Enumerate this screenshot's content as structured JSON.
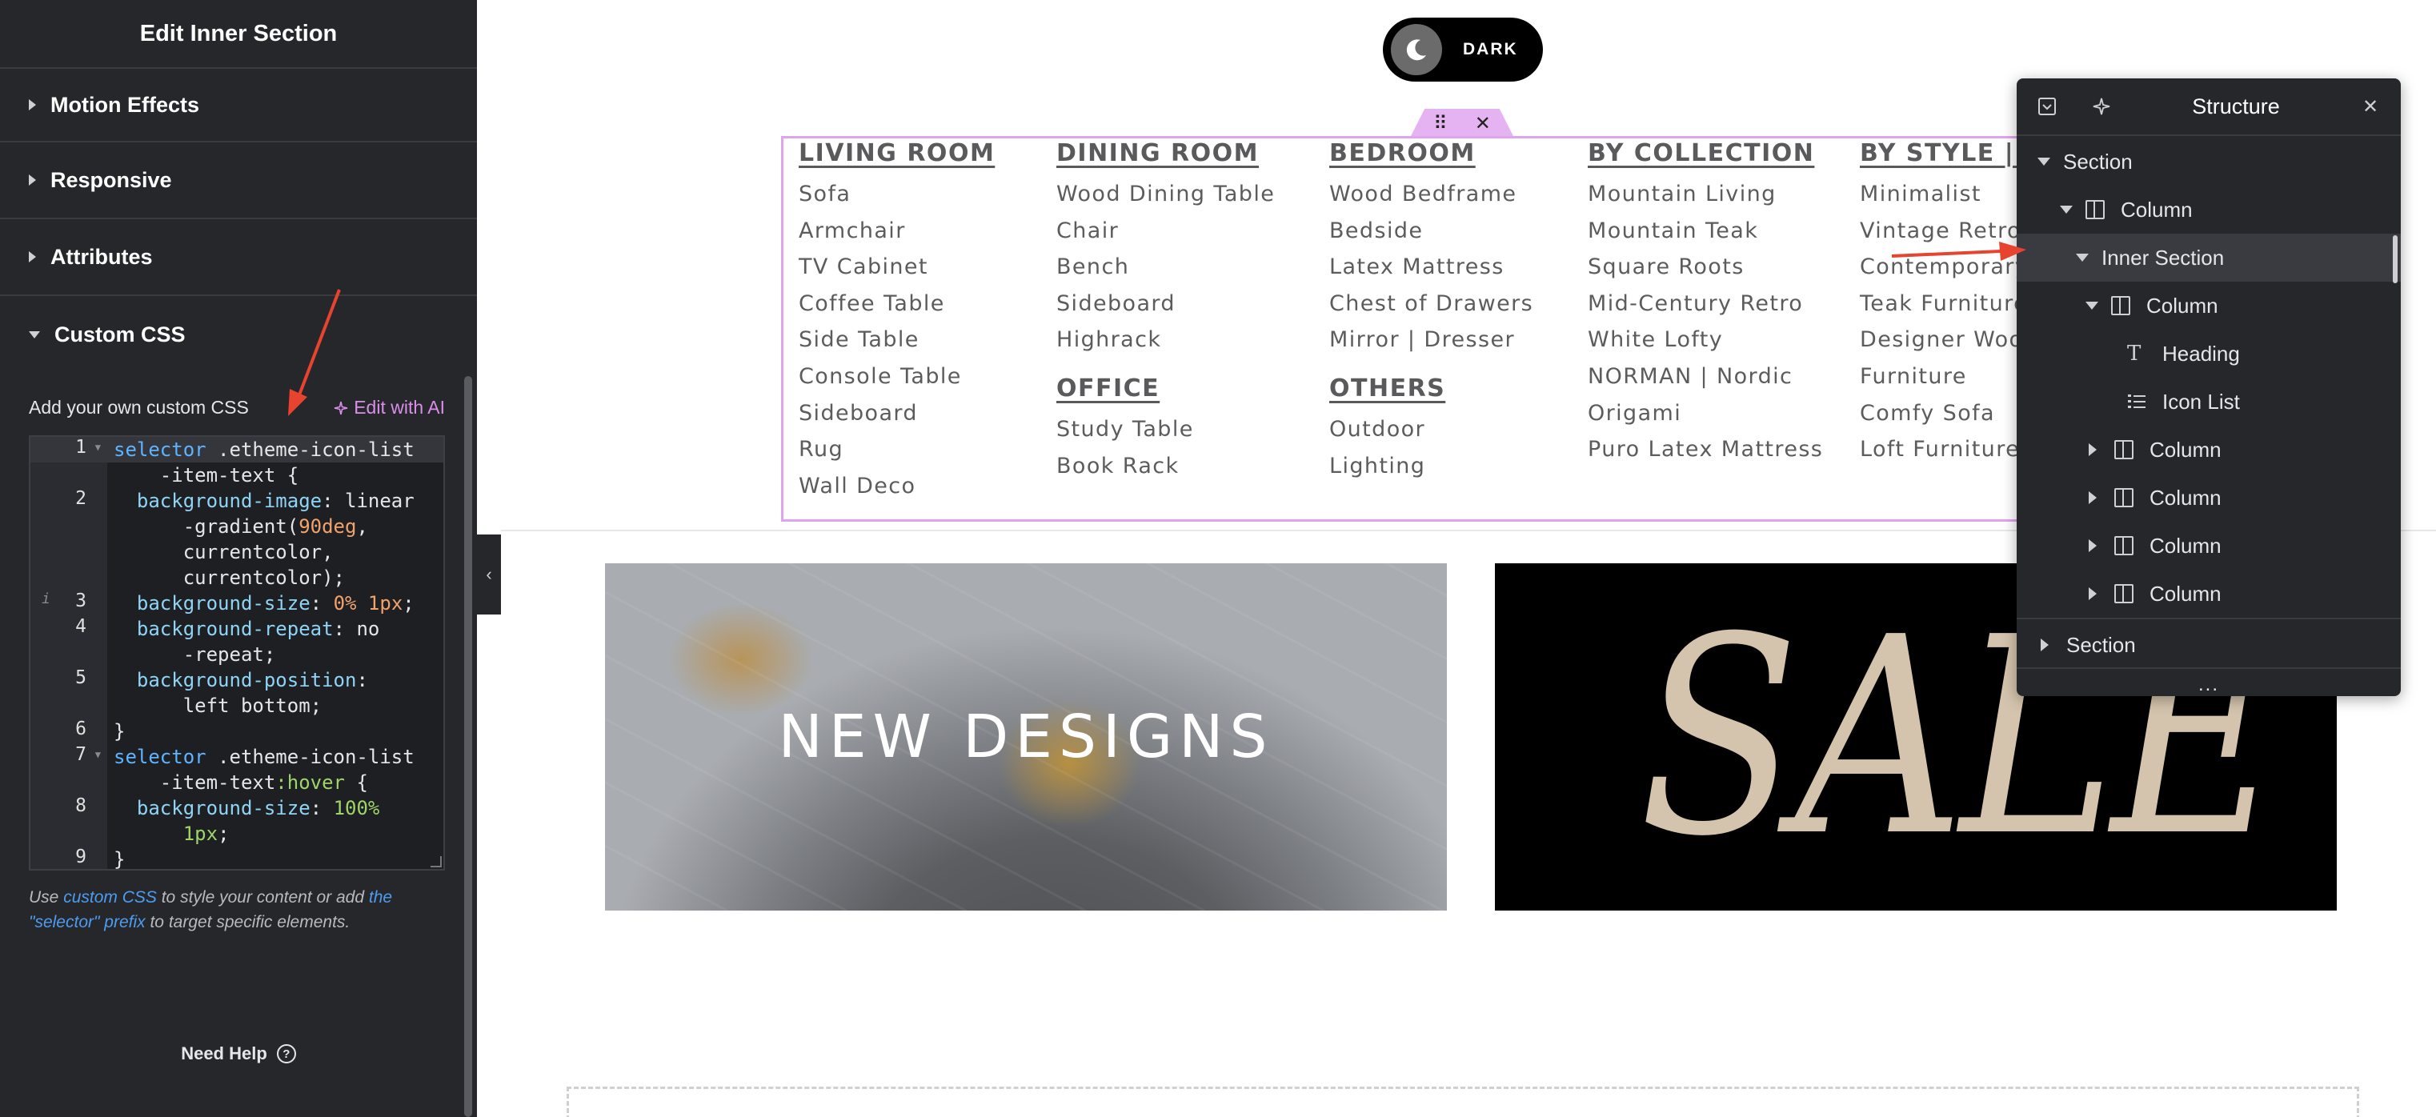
{
  "panel": {
    "title": "Edit Inner Section",
    "sections": {
      "motion": "Motion Effects",
      "responsive": "Responsive",
      "attributes": "Attributes",
      "custom_css": "Custom CSS"
    },
    "custom_css": {
      "label": "Add your own custom CSS",
      "edit_ai": "Edit with AI",
      "help_prefix": "Use ",
      "help_link1": "custom CSS",
      "help_middle": " to style your content or add ",
      "help_link2": "the \"selector\" prefix",
      "help_suffix": " to target specific elements."
    },
    "need_help": "Need Help"
  },
  "code_lines": [
    "1",
    "2",
    "3",
    "4",
    "5",
    "6",
    "7",
    "8",
    "9"
  ],
  "toggle": {
    "label": "DARK"
  },
  "menu": {
    "living": {
      "heading": "LIVING ROOM",
      "items": [
        "Sofa",
        "Armchair",
        "TV Cabinet",
        "Coffee Table",
        "Side Table",
        "Console Table",
        "Sideboard",
        "Rug",
        "Wall Deco"
      ]
    },
    "dining": {
      "heading": "DINING ROOM",
      "items": [
        "Wood Dining Table",
        "Chair",
        "Bench",
        "Sideboard",
        "Highrack"
      ]
    },
    "office": {
      "heading": "OFFICE",
      "items": [
        "Study Table",
        "Book Rack"
      ]
    },
    "bedroom": {
      "heading": "BEDROOM",
      "items": [
        "Wood Bedframe",
        "Bedside",
        "Latex Mattress",
        "Chest of Drawers",
        "Mirror | Dresser"
      ]
    },
    "others": {
      "heading": "OTHERS",
      "items": [
        "Outdoor",
        "Lighting"
      ]
    },
    "collection": {
      "heading": "BY COLLECTION",
      "items": [
        "Mountain Living",
        "Mountain Teak",
        "Square Roots",
        "Mid-Century Retro",
        "White Lofty",
        "NORMAN | Nordic",
        "Origami",
        "Puro Latex Mattress"
      ]
    },
    "style": {
      "heading": "BY STYLE | MA",
      "items": [
        "Minimalist",
        "Vintage Retro",
        "Contemporary",
        "Teak Furniture",
        "Designer Wood",
        "Furniture",
        "Comfy Sofa",
        "Loft Furniture"
      ]
    }
  },
  "banners": {
    "new": "NEW DESIGNS",
    "sale": "SALE"
  },
  "structure": {
    "title": "Structure",
    "rows": [
      "Section",
      "Column",
      "Inner Section",
      "Column",
      "Heading",
      "Icon List",
      "Column",
      "Column",
      "Column",
      "Column",
      "Section"
    ],
    "more": "..."
  },
  "colors": {
    "panel_bg": "#26272b",
    "accent_pink": "#e0a4ee",
    "arrow_red": "#e8432e",
    "link_blue": "#4d9cf0"
  }
}
